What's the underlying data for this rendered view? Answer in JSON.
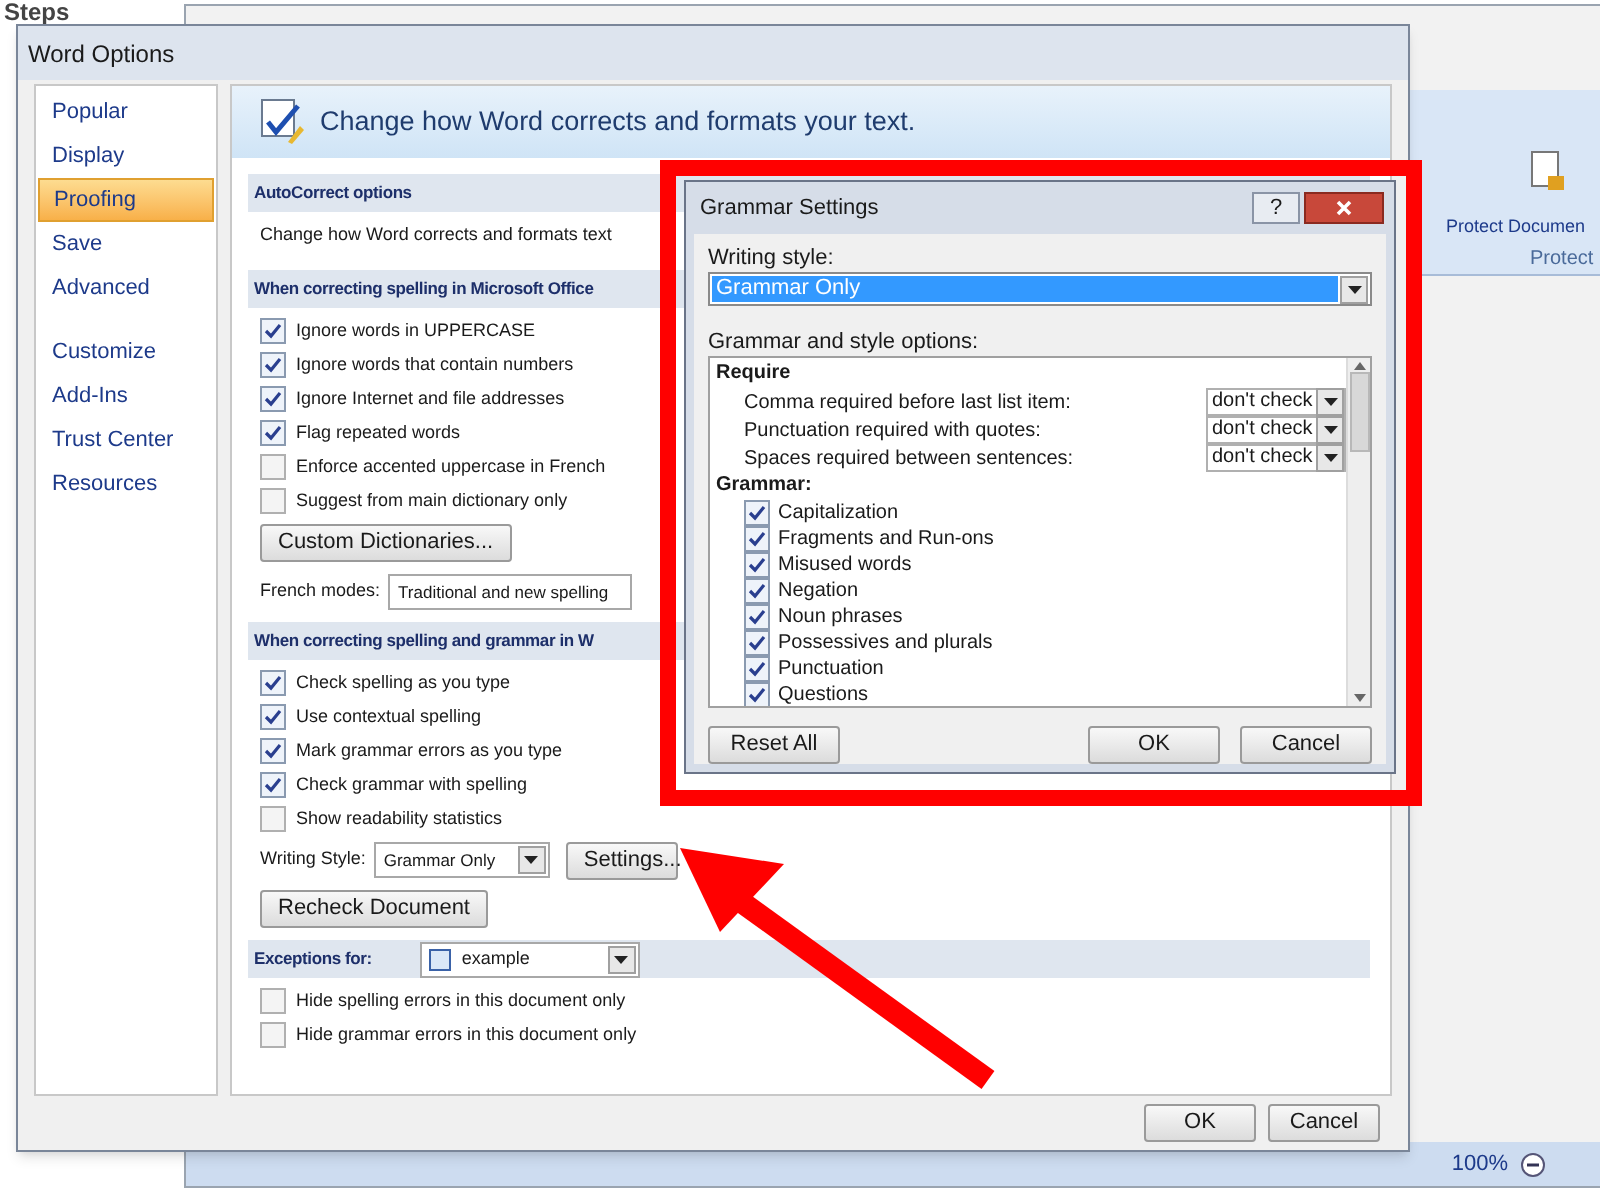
{
  "page": {
    "heading": "Steps"
  },
  "word_window": {
    "ribbon_button": "Protect Documen",
    "ribbon_group": "Protect",
    "zoom": "100%"
  },
  "options_dialog": {
    "title": "Word Options",
    "sidebar": [
      {
        "label": "Popular",
        "selected": false
      },
      {
        "label": "Display",
        "selected": false
      },
      {
        "label": "Proofing",
        "selected": true
      },
      {
        "label": "Save",
        "selected": false
      },
      {
        "label": "Advanced",
        "selected": false
      },
      {
        "label": "Customize",
        "selected": false
      },
      {
        "label": "Add-Ins",
        "selected": false
      },
      {
        "label": "Trust Center",
        "selected": false
      },
      {
        "label": "Resources",
        "selected": false
      }
    ],
    "banner": "Change how Word corrects and formats your text.",
    "sections": [
      {
        "heading": "AutoCorrect options",
        "items": [
          {
            "kind": "text",
            "text": "Change how Word corrects and formats text"
          }
        ]
      },
      {
        "heading": "When correcting spelling in Microsoft Office",
        "items": [
          {
            "kind": "checkbox",
            "label": "Ignore words in UPPERCASE",
            "checked": true
          },
          {
            "kind": "checkbox",
            "label": "Ignore words that contain numbers",
            "checked": true
          },
          {
            "kind": "checkbox",
            "label": "Ignore Internet and file addresses",
            "checked": true
          },
          {
            "kind": "checkbox",
            "label": "Flag repeated words",
            "checked": true
          },
          {
            "kind": "checkbox",
            "label": "Enforce accented uppercase in French",
            "checked": false
          },
          {
            "kind": "checkbox",
            "label": "Suggest from main dictionary only",
            "checked": false
          },
          {
            "kind": "button",
            "label": "Custom Dictionaries..."
          },
          {
            "kind": "select",
            "label": "French modes:",
            "value": "Traditional and new spelling"
          }
        ]
      },
      {
        "heading": "When correcting spelling and grammar in W",
        "items": [
          {
            "kind": "checkbox",
            "label": "Check spelling as you type",
            "checked": true
          },
          {
            "kind": "checkbox",
            "label": "Use contextual spelling",
            "checked": true
          },
          {
            "kind": "checkbox",
            "label": "Mark grammar errors as you type",
            "checked": true
          },
          {
            "kind": "checkbox",
            "label": "Check grammar with spelling",
            "checked": true
          },
          {
            "kind": "checkbox",
            "label": "Show readability statistics",
            "checked": false
          },
          {
            "kind": "select",
            "label": "Writing Style:",
            "value": "Grammar Only",
            "button": "Settings..."
          },
          {
            "kind": "button",
            "label": "Recheck Document"
          }
        ]
      },
      {
        "heading": "Exceptions for:",
        "select": "example",
        "items": [
          {
            "kind": "checkbox",
            "label": "Hide spelling errors in this document only",
            "checked": false
          },
          {
            "kind": "checkbox",
            "label": "Hide grammar errors in this document only",
            "checked": false
          }
        ]
      }
    ],
    "buttons": [
      "OK",
      "Cancel"
    ]
  },
  "grammar_dialog": {
    "title": "Grammar Settings",
    "help": "?",
    "writing_style_label": "Writing style:",
    "writing_style": "Grammar Only",
    "options_label": "Grammar and style options:",
    "groups": [
      {
        "heading": "Require",
        "items": [
          {
            "kind": "select",
            "label": "Comma required before last list item:",
            "value": "don't check"
          },
          {
            "kind": "select",
            "label": "Punctuation required with quotes:",
            "value": "don't check"
          },
          {
            "kind": "select",
            "label": "Spaces required between sentences:",
            "value": "don't check"
          }
        ]
      },
      {
        "heading": "Grammar:",
        "items": [
          {
            "kind": "checkbox",
            "label": "Capitalization",
            "checked": true
          },
          {
            "kind": "checkbox",
            "label": "Fragments and Run-ons",
            "checked": true
          },
          {
            "kind": "checkbox",
            "label": "Misused words",
            "checked": true
          },
          {
            "kind": "checkbox",
            "label": "Negation",
            "checked": true
          },
          {
            "kind": "checkbox",
            "label": "Noun phrases",
            "checked": true
          },
          {
            "kind": "checkbox",
            "label": "Possessives and plurals",
            "checked": true
          },
          {
            "kind": "checkbox",
            "label": "Punctuation",
            "checked": true
          },
          {
            "kind": "checkbox",
            "label": "Questions",
            "checked": true
          }
        ]
      }
    ],
    "reset": "Reset All",
    "ok": "OK",
    "cancel": "Cancel"
  }
}
